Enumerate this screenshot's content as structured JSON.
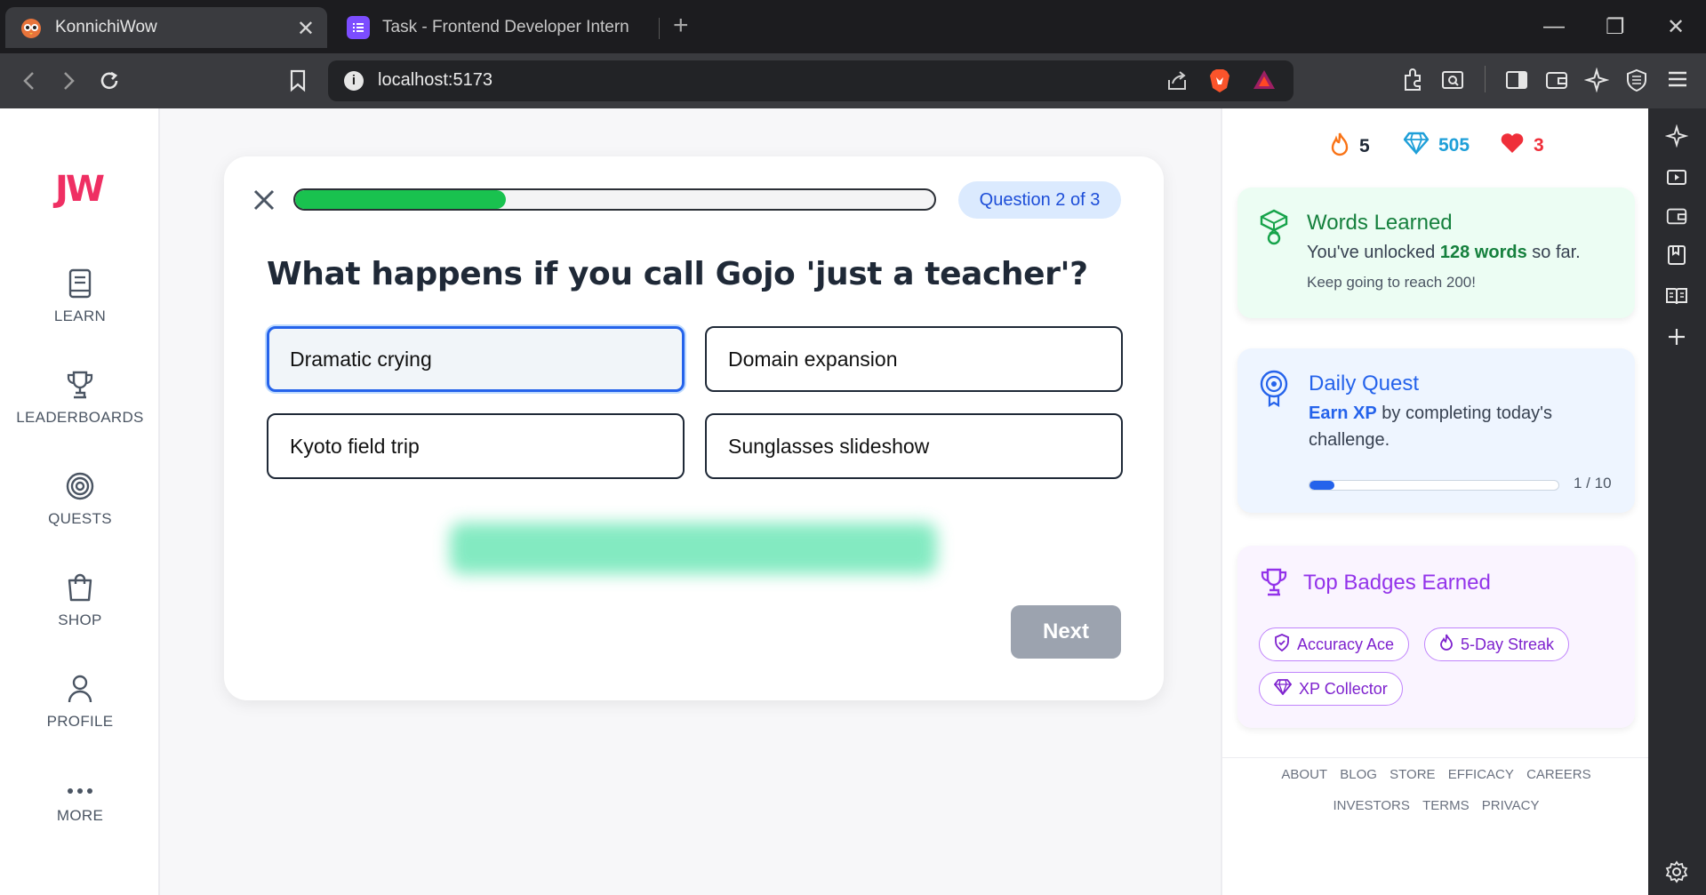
{
  "browser": {
    "tabs": [
      {
        "title": "KonnichiWow",
        "active": true
      },
      {
        "title": "Task - Frontend Developer Intern",
        "active": false
      }
    ],
    "url": "localhost:5173"
  },
  "sidebar": {
    "logo": "JW",
    "items": [
      {
        "label": "LEARN",
        "icon": "book-icon"
      },
      {
        "label": "LEADERBOARDS",
        "icon": "trophy-icon"
      },
      {
        "label": "QUESTS",
        "icon": "target-icon"
      },
      {
        "label": "SHOP",
        "icon": "shopping-bag-icon"
      },
      {
        "label": "PROFILE",
        "icon": "user-icon"
      },
      {
        "label": "MORE",
        "icon": "more-dots-icon"
      }
    ]
  },
  "quiz": {
    "progress_fraction": 0.33,
    "question_badge": "Question 2 of 3",
    "question": "What happens if you call Gojo 'just a teacher'?",
    "options": [
      {
        "label": "Dramatic crying",
        "selected": true
      },
      {
        "label": "Domain expansion",
        "selected": false
      },
      {
        "label": "Kyoto field trip",
        "selected": false
      },
      {
        "label": "Sunglasses slideshow",
        "selected": false
      }
    ],
    "next_label": "Next"
  },
  "stats": {
    "streak": "5",
    "gems": "505",
    "hearts": "3"
  },
  "words_card": {
    "title": "Words Learned",
    "line_prefix": "You've unlocked ",
    "line_bold": "128 words",
    "line_suffix": " so far.",
    "subline": "Keep going to reach 200!"
  },
  "quest_card": {
    "title": "Daily Quest",
    "line_bold": "Earn XP",
    "line_rest": " by completing today's challenge.",
    "progress_value": 1,
    "progress_max": 10,
    "progress_text": "1 / 10"
  },
  "badges_card": {
    "title": "Top Badges Earned",
    "badges": [
      "Accuracy Ace",
      "5-Day Streak",
      "XP Collector"
    ]
  },
  "footer": {
    "row1": [
      "ABOUT",
      "BLOG",
      "STORE",
      "EFFICACY",
      "CAREERS"
    ],
    "row2": [
      "INVESTORS",
      "TERMS",
      "PRIVACY"
    ]
  },
  "colors": {
    "brand": "#ef2f63",
    "progress_green": "#19c24f",
    "quest_blue": "#2563eb",
    "badge_purple": "#7e22ce",
    "words_green": "#15803d"
  }
}
